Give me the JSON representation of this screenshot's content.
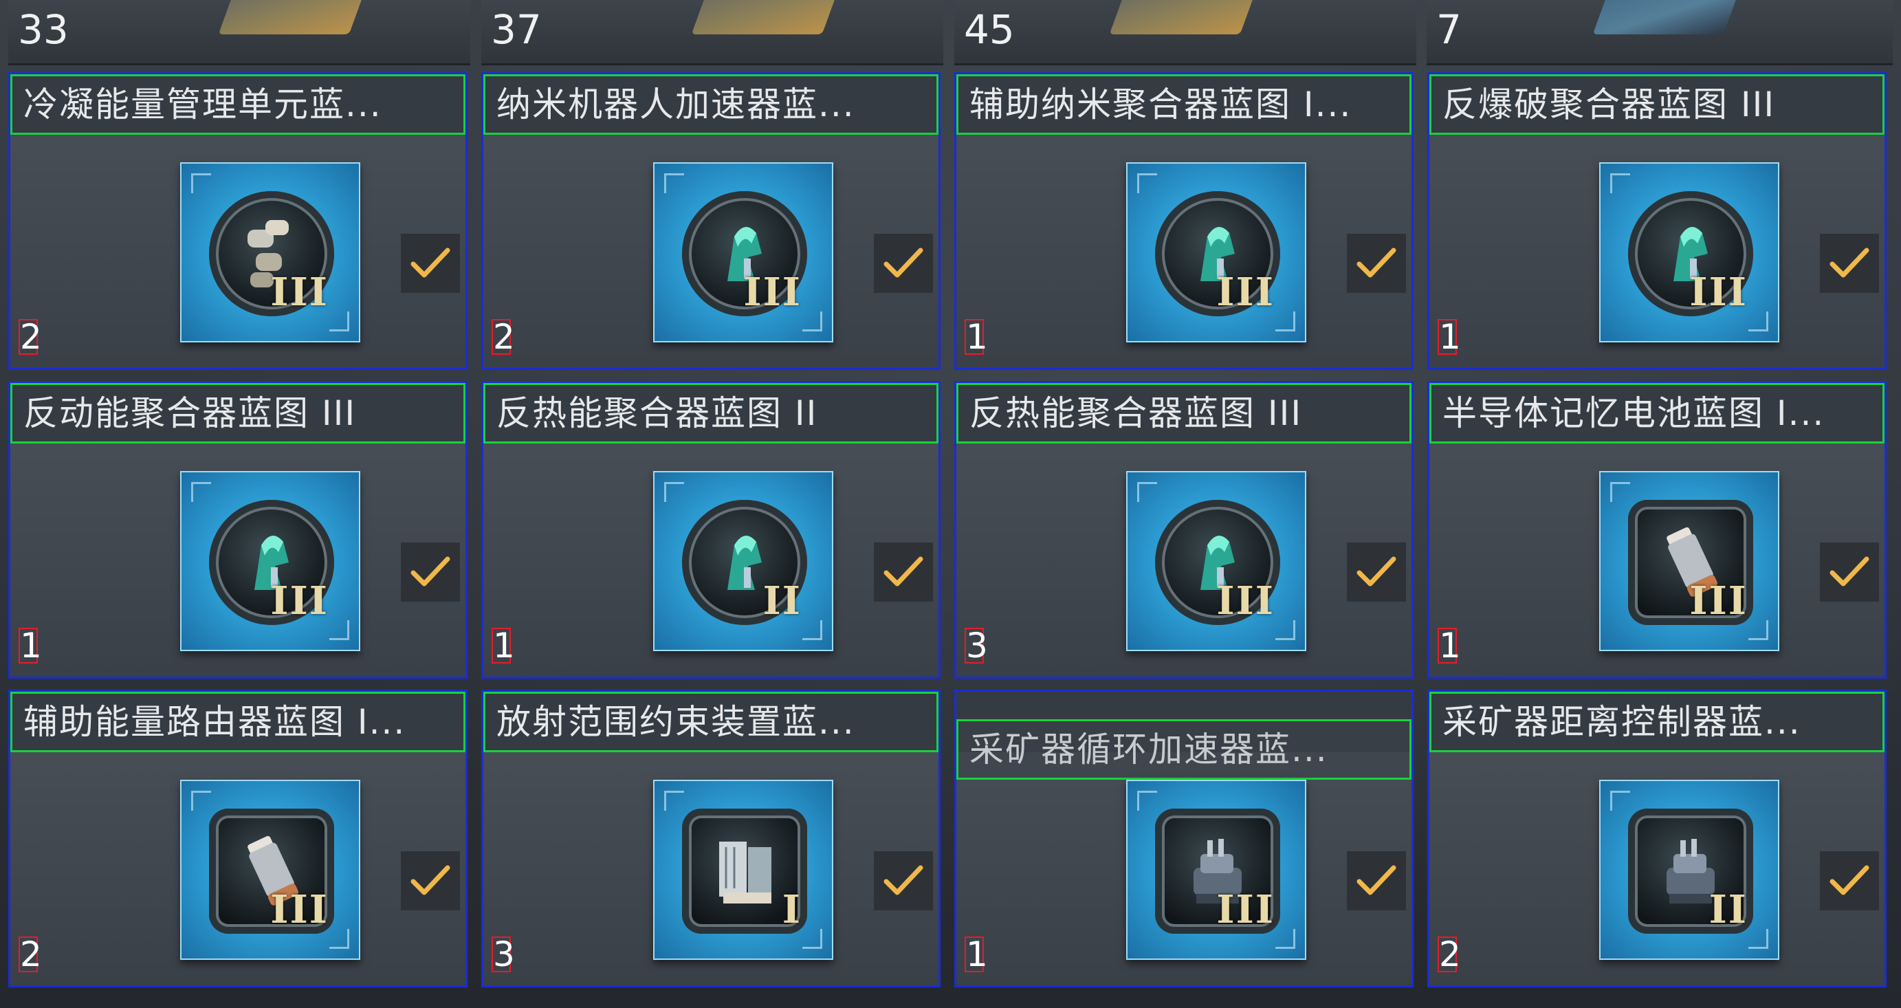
{
  "top_row": {
    "counts": [
      "33",
      "37",
      "45",
      "7"
    ]
  },
  "items": [
    {
      "title": "冷凝能量管理单元蓝...",
      "tier": "III",
      "qty": "2",
      "icon": "condenser-icon",
      "selected": true
    },
    {
      "title": "纳米机器人加速器蓝...",
      "tier": "III",
      "qty": "2",
      "icon": "nano-helmet-icon",
      "selected": true
    },
    {
      "title": "辅助纳米聚合器蓝图 I...",
      "tier": "III",
      "qty": "1",
      "icon": "nano-helmet-icon",
      "selected": true
    },
    {
      "title": "反爆破聚合器蓝图 III",
      "tier": "III",
      "qty": "1",
      "icon": "nano-helmet-icon",
      "selected": true
    },
    {
      "title": "反动能聚合器蓝图 III",
      "tier": "III",
      "qty": "1",
      "icon": "nano-helmet-icon",
      "selected": true
    },
    {
      "title": "反热能聚合器蓝图 II",
      "tier": "II",
      "qty": "1",
      "icon": "nano-helmet-icon",
      "selected": true
    },
    {
      "title": "反热能聚合器蓝图 III",
      "tier": "III",
      "qty": "3",
      "icon": "nano-helmet-icon",
      "selected": true
    },
    {
      "title": "半导体记忆电池蓝图 I...",
      "tier": "III",
      "qty": "1",
      "icon": "battery-icon",
      "selected": true
    },
    {
      "title": "辅助能量路由器蓝图 I...",
      "tier": "III",
      "qty": "2",
      "icon": "battery-icon",
      "selected": true
    },
    {
      "title": "放射范围约束装置蓝...",
      "tier": "I",
      "qty": "3",
      "icon": "circuit-board-icon",
      "selected": true
    },
    {
      "title": "采矿器循环加速器蓝...",
      "tier": "III",
      "qty": "1",
      "icon": "mining-turret-icon",
      "selected": true
    },
    {
      "title": "采矿器距离控制器蓝...",
      "tier": "II",
      "qty": "2",
      "icon": "mining-turret-icon",
      "selected": true
    }
  ],
  "colors": {
    "item_border": "#1b2cd6",
    "title_border": "#19d23a",
    "qty_border": "#e61c2a",
    "check": "#f0b84a",
    "icon_bg": "#2ea0d6"
  }
}
